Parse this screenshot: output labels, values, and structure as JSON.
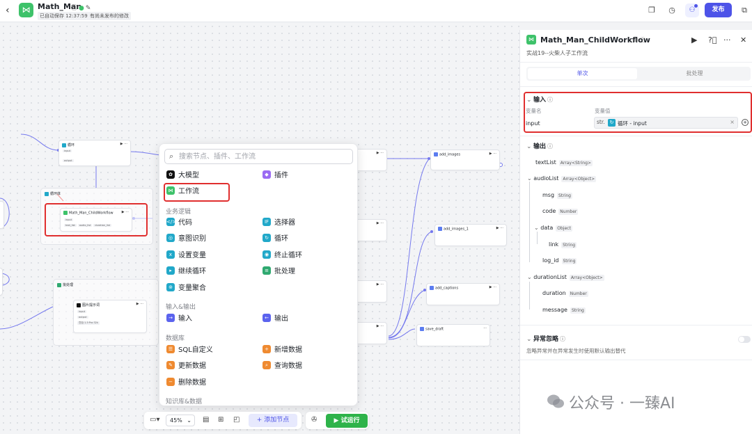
{
  "header": {
    "app_name": "Math_Man",
    "saved_tag": "已自动保存 12:37:59",
    "unpublished_tag": "有尚未发布的修改",
    "publish_label": "发布"
  },
  "canvas": {
    "nodes": {
      "loop_top": {
        "title": "循环",
        "r1": "input",
        "r2": "output"
      },
      "loop_body": {
        "title": "循环体"
      },
      "child": {
        "title": "Math_Man_ChildWorkflow",
        "r1": "input",
        "r2a": "text_list",
        "r2b": "audio_list",
        "r2c": "duration_list"
      },
      "batch": {
        "title": "批处理"
      },
      "image_prompt": {
        "title": "图片提示词",
        "r1": "input",
        "r2": "output",
        "r3": "豆包·1.5·Pro·32k"
      },
      "add_images": {
        "title": "add_images"
      },
      "add_images_1": {
        "title": "add_images_1"
      },
      "add_captions": {
        "title": "add_captions"
      },
      "save_draft": {
        "title": "save_draft"
      }
    }
  },
  "menu": {
    "search_placeholder": "搜索节点、插件、工作流",
    "items": {
      "llm": "大模型",
      "plugin": "插件",
      "workflow": "工作流",
      "code": "代码",
      "selector": "选择器",
      "intent": "意图识别",
      "loop": "循环",
      "setvar": "设置变量",
      "stoploop": "终止循环",
      "continue": "继续循环",
      "batch": "批处理",
      "varagg": "变量聚合",
      "input": "输入",
      "output": "输出",
      "sql": "SQL自定义",
      "adddata": "新增数据",
      "update": "更新数据",
      "query": "查询数据",
      "delete": "删除数据"
    },
    "sections": {
      "logic": "业务逻辑",
      "io": "输入&输出",
      "db": "数据库",
      "kb": "知识库&数据"
    }
  },
  "toolbar": {
    "zoom": "45%",
    "add_node": "添加节点",
    "trial_run": "试运行"
  },
  "panel": {
    "title": "Math_Man_ChildWorkflow",
    "subtitle": "实战19--火柴人子工作流",
    "tab_single": "单次",
    "tab_batch": "批处理",
    "input_section": "输入",
    "col_name": "变量名",
    "col_value": "变量值",
    "input_name": "input",
    "input_type": "str.",
    "input_ref": "循环 - input",
    "output_section": "输出",
    "outputs": {
      "textList": {
        "name": "textList",
        "type": "Array<String>"
      },
      "audioList": {
        "name": "audioList",
        "type": "Array<Object>"
      },
      "msg": {
        "name": "msg",
        "type": "String"
      },
      "code": {
        "name": "code",
        "type": "Number"
      },
      "data": {
        "name": "data",
        "type": "Object"
      },
      "link": {
        "name": "link",
        "type": "String"
      },
      "log_id": {
        "name": "log_id",
        "type": "String"
      },
      "durationList": {
        "name": "durationList",
        "type": "Array<Object>"
      },
      "duration": {
        "name": "duration",
        "type": "Number"
      },
      "message": {
        "name": "message",
        "type": "String"
      }
    },
    "error_section": "异常忽略",
    "error_desc": "忽略异常并在异常发生时使用默认输出替代"
  },
  "watermark": "公众号 · 一臻AI",
  "colors": {
    "accent": "#4d53e8",
    "green": "#3ec26a",
    "run": "#2eb34a",
    "highlight": "#e02e2e"
  }
}
